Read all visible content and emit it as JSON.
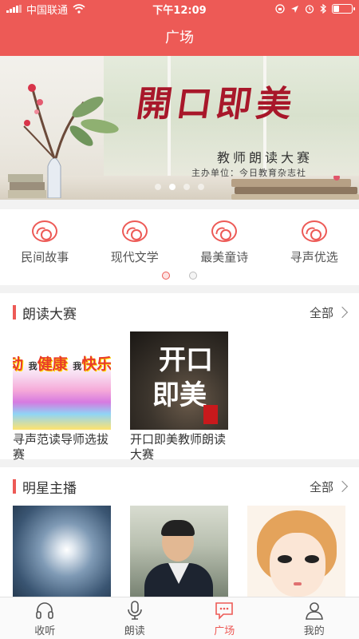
{
  "status_bar": {
    "carrier": "中国联通",
    "time": "下午12:09"
  },
  "header": {
    "title": "广场"
  },
  "banner": {
    "title": "開口即美",
    "subtitle": "教师朗读大赛",
    "host": "主办单位：今日教育杂志社",
    "slide_count": 4,
    "active_slide": 2
  },
  "categories": {
    "items": [
      {
        "label": "民间故事",
        "icon": "disc-icon"
      },
      {
        "label": "现代文学",
        "icon": "disc-icon"
      },
      {
        "label": "最美童诗",
        "icon": "disc-icon"
      },
      {
        "label": "寻声优选",
        "icon": "disc-icon"
      }
    ],
    "pages": 2,
    "active_page": 1
  },
  "contest_section": {
    "title": "朗读大赛",
    "more_label": "全部",
    "cards": [
      {
        "caption": "寻声范读导师选拔赛",
        "image_text": "动 我健康 我快乐"
      },
      {
        "caption": "开口即美教师朗读大赛",
        "image_text": "开口 即美"
      }
    ]
  },
  "star_section": {
    "title": "明星主播",
    "more_label": "全部",
    "cards": [
      {
        "caption": "",
        "image": "sky-photo"
      },
      {
        "caption": "",
        "image": "boy-photo"
      },
      {
        "caption": "",
        "image": "girl-drawing"
      }
    ]
  },
  "tab_bar": {
    "items": [
      {
        "label": "收听",
        "icon": "headphones-icon"
      },
      {
        "label": "朗读",
        "icon": "microphone-icon"
      },
      {
        "label": "广场",
        "icon": "chat-bubble-icon",
        "active": true
      },
      {
        "label": "我的",
        "icon": "user-icon"
      }
    ]
  },
  "colors": {
    "accent": "#ed5a56"
  }
}
